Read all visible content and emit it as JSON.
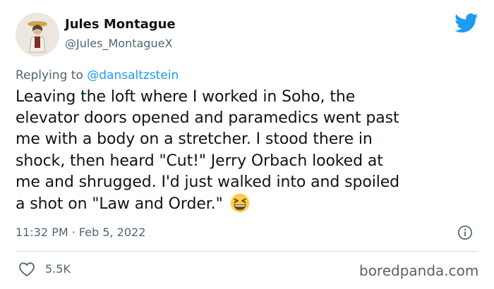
{
  "author": {
    "display_name": "Jules Montague",
    "handle": "@Jules_MontagueX",
    "avatar_icon": "portrait-avatar"
  },
  "reply": {
    "prefix": "Replying to",
    "mention": "@dansaltzstein"
  },
  "tweet": {
    "lines": [
      "Leaving the loft where I worked in Soho, the",
      "elevator doors opened and paramedics went past",
      "me with a body on a stretcher. I stood there in",
      "shock, then heard \"Cut!\" Jerry Orbach looked at",
      "me and shrugged. I'd just walked into and spoiled",
      "a shot on \"Law and Order.\""
    ],
    "emoji": "grinning-squinting-face",
    "timestamp": "11:32 PM · Feb 5, 2022"
  },
  "stats": {
    "likes": "5.5K"
  },
  "watermark": "boredpanda.com",
  "colors": {
    "twitter_blue": "#1d9bf0",
    "secondary_text": "#536471",
    "divider": "#cfd9de"
  }
}
